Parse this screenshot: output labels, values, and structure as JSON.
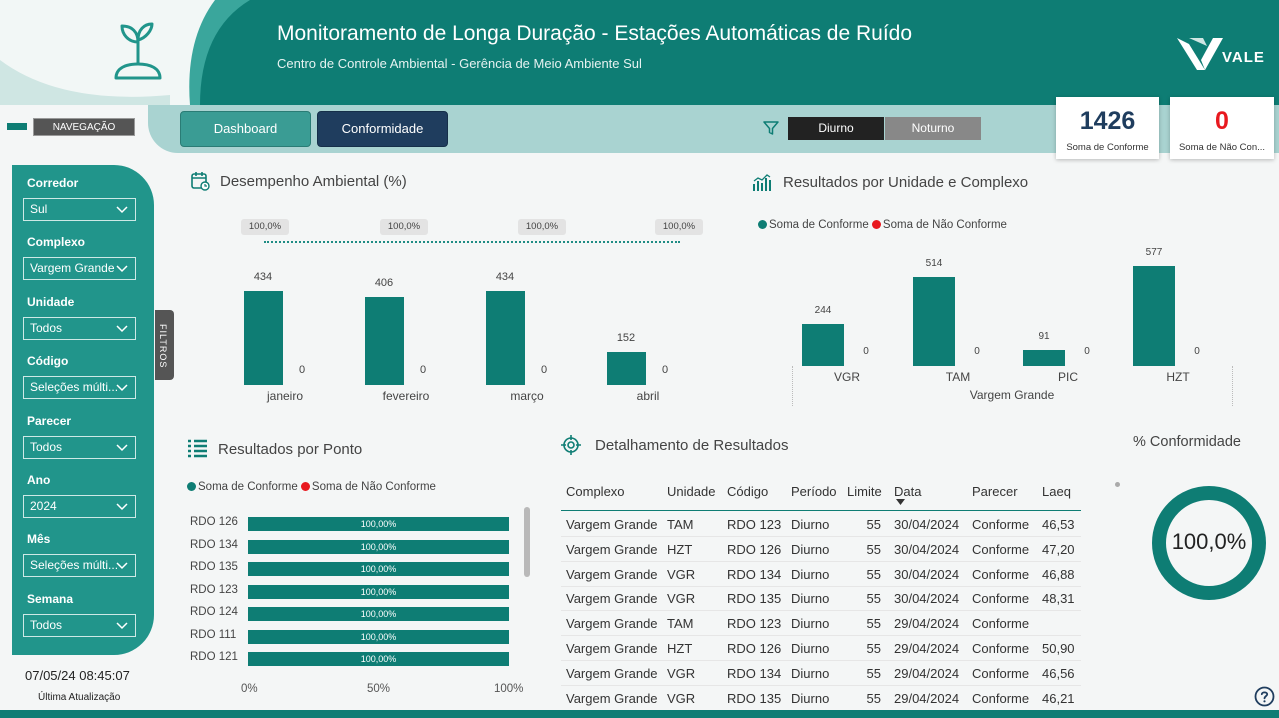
{
  "header": {
    "title": "Monitoramento de Longa Duração - Estações Automáticas de Ruído",
    "subtitle": "Centro de Controle Ambiental - Gerência de Meio Ambiente Sul",
    "brand": "VALE",
    "colors": {
      "primary": "#0e7d74",
      "accent": "#21958b",
      "dark_button": "#1f3d5e",
      "nonconform": "#e8191f"
    }
  },
  "nav": {
    "label": "NAVEGAÇÃO",
    "dashboard": "Dashboard",
    "conformidade": "Conformidade",
    "diurno": "Diurno",
    "noturno": "Noturno"
  },
  "kpis": {
    "conforme_value": "1426",
    "conforme_label": "Soma de Conforme",
    "nao_conforme_value": "0",
    "nao_conforme_label": "Soma de Não Con..."
  },
  "filters": {
    "tab_label": "FILTROS",
    "items": [
      {
        "label": "Corredor",
        "value": "Sul"
      },
      {
        "label": "Complexo",
        "value": "Vargem Grande"
      },
      {
        "label": "Unidade",
        "value": "Todos"
      },
      {
        "label": "Código",
        "value": "Seleções múlti..."
      },
      {
        "label": "Parecer",
        "value": "Todos"
      },
      {
        "label": "Ano",
        "value": "2024"
      },
      {
        "label": "Mês",
        "value": "Seleções múlti..."
      },
      {
        "label": "Semana",
        "value": "Todos"
      }
    ],
    "last_update": "07/05/24 08:45:07",
    "last_update_label": "Última Atualização"
  },
  "sections": {
    "desempenho": "Desempenho Ambiental (%)",
    "resultados_unidade": "Resultados por Unidade e Complexo",
    "resultados_ponto": "Resultados por Ponto",
    "detalhamento": "Detalhamento de Resultados",
    "conformidade_pct": "% Conformidade"
  },
  "legend": {
    "conforme": "Soma de Conforme",
    "nao_conforme": "Soma de Não Conforme"
  },
  "chart_data": [
    {
      "type": "bar",
      "title": "Desempenho Ambiental (%)",
      "categories": [
        "janeiro",
        "fevereiro",
        "março",
        "abril"
      ],
      "series": [
        {
          "name": "Soma de Conforme",
          "values": [
            434,
            406,
            434,
            152
          ]
        },
        {
          "name": "Soma de Não Conforme",
          "values": [
            0,
            0,
            0,
            0
          ]
        }
      ],
      "percent_line": [
        "100,0%",
        "100,0%",
        "100,0%",
        "100,0%"
      ]
    },
    {
      "type": "bar",
      "title": "Resultados por Unidade e Complexo",
      "categories": [
        "VGR",
        "TAM",
        "PIC",
        "HZT"
      ],
      "group_label": "Vargem Grande",
      "series": [
        {
          "name": "Soma de Conforme",
          "values": [
            244,
            514,
            91,
            577
          ]
        },
        {
          "name": "Soma de Não Conforme",
          "values": [
            0,
            0,
            0,
            0
          ]
        }
      ]
    },
    {
      "type": "bar",
      "title": "Resultados por Ponto",
      "orientation": "horizontal",
      "categories": [
        "RDO 126",
        "RDO 134",
        "RDO 135",
        "RDO 123",
        "RDO 124",
        "RDO 111",
        "RDO 121"
      ],
      "values": [
        100,
        100,
        100,
        100,
        100,
        100,
        100
      ],
      "value_labels": [
        "100,00%",
        "100,00%",
        "100,00%",
        "100,00%",
        "100,00%",
        "100,00%",
        "100,00%"
      ],
      "x_ticks": [
        "0%",
        "50%",
        "100%"
      ]
    },
    {
      "type": "pie",
      "title": "% Conformidade",
      "value": 100.0,
      "label": "100,0%"
    }
  ],
  "table": {
    "columns": [
      "Complexo",
      "Unidade",
      "Código",
      "Período",
      "Limite",
      "Data",
      "Parecer",
      "Laeq"
    ],
    "rows": [
      [
        "Vargem Grande",
        "TAM",
        "RDO 123",
        "Diurno",
        "55",
        "30/04/2024",
        "Conforme",
        "46,53"
      ],
      [
        "Vargem Grande",
        "HZT",
        "RDO 126",
        "Diurno",
        "55",
        "30/04/2024",
        "Conforme",
        "47,20"
      ],
      [
        "Vargem Grande",
        "VGR",
        "RDO 134",
        "Diurno",
        "55",
        "30/04/2024",
        "Conforme",
        "46,88"
      ],
      [
        "Vargem Grande",
        "VGR",
        "RDO 135",
        "Diurno",
        "55",
        "30/04/2024",
        "Conforme",
        "48,31"
      ],
      [
        "Vargem Grande",
        "TAM",
        "RDO 123",
        "Diurno",
        "55",
        "29/04/2024",
        "Conforme",
        ""
      ],
      [
        "Vargem Grande",
        "HZT",
        "RDO 126",
        "Diurno",
        "55",
        "29/04/2024",
        "Conforme",
        "50,90"
      ],
      [
        "Vargem Grande",
        "VGR",
        "RDO 134",
        "Diurno",
        "55",
        "29/04/2024",
        "Conforme",
        "46,56"
      ],
      [
        "Vargem Grande",
        "VGR",
        "RDO 135",
        "Diurno",
        "55",
        "29/04/2024",
        "Conforme",
        "46,21"
      ]
    ]
  }
}
